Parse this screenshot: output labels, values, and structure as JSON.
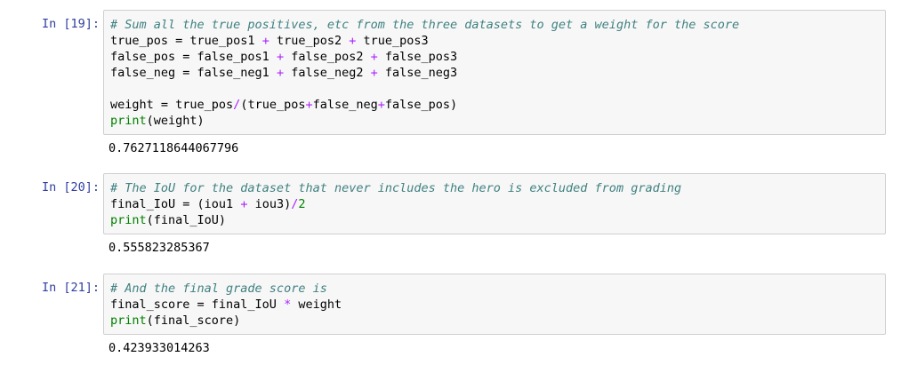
{
  "cells": [
    {
      "prompt": "In [19]:",
      "lines": {
        "l1": "# Sum all the true positives, etc from the three datasets to get a weight for the score",
        "l2a": "true_pos = true_pos1 ",
        "l2op1": "+",
        "l2b": " true_pos2 ",
        "l2op2": "+",
        "l2c": " true_pos3",
        "l3a": "false_pos = false_pos1 ",
        "l3op1": "+",
        "l3b": " false_pos2 ",
        "l3op2": "+",
        "l3c": " false_pos3",
        "l4a": "false_neg = false_neg1 ",
        "l4op1": "+",
        "l4b": " false_neg2 ",
        "l4op2": "+",
        "l4c": " false_neg3",
        "l6a": "weight = true_pos",
        "l6op1": "/",
        "l6b": "(true_pos",
        "l6op2": "+",
        "l6c": "false_neg",
        "l6op3": "+",
        "l6d": "false_pos)",
        "l7fn": "print",
        "l7rest": "(weight)"
      },
      "output": "0.7627118644067796"
    },
    {
      "prompt": "In [20]:",
      "lines": {
        "l1": "# The IoU for the dataset that never includes the hero is excluded from grading",
        "l2a": "final_IoU = (iou1 ",
        "l2op1": "+",
        "l2b": " iou3)",
        "l2op2": "/",
        "l2num": "2",
        "l3fn": "print",
        "l3rest": "(final_IoU)"
      },
      "output": "0.555823285367"
    },
    {
      "prompt": "In [21]:",
      "lines": {
        "l1": "# And the final grade score is",
        "l2a": "final_score = final_IoU ",
        "l2op1": "*",
        "l2b": " weight",
        "l3fn": "print",
        "l3rest": "(final_score)"
      },
      "output": "0.423933014263"
    }
  ],
  "colors": {
    "prompt": "#303f9f",
    "comment": "#408080",
    "operator": "#aa22ff",
    "builtin": "#008000",
    "input_background": "#f7f7f7",
    "input_border": "#cfcfcf"
  }
}
